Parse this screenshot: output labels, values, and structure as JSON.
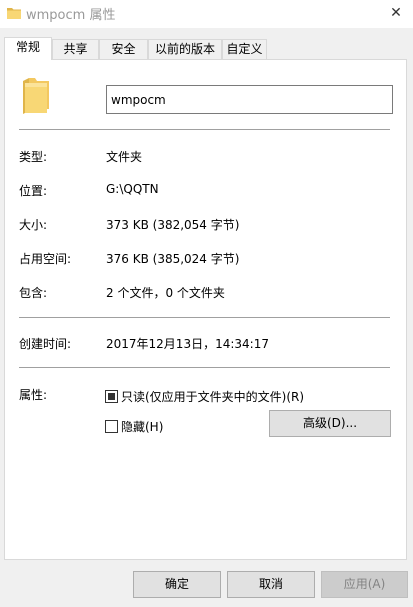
{
  "window": {
    "title": "wmpocm 属性",
    "close_glyph": "✕"
  },
  "tabs": [
    {
      "label": "常规",
      "active": true
    },
    {
      "label": "共享"
    },
    {
      "label": "安全"
    },
    {
      "label": "以前的版本"
    },
    {
      "label": "自定义"
    }
  ],
  "general": {
    "name_value": "wmpocm",
    "properties": [
      {
        "label": "类型:",
        "value": "文件夹"
      },
      {
        "label": "位置:",
        "value": "G:\\QQTN"
      },
      {
        "label": "大小:",
        "value": "373 KB (382,054 字节)"
      },
      {
        "label": "占用空间:",
        "value": "376 KB (385,024 字节)"
      },
      {
        "label": "包含:",
        "value": "2 个文件，0 个文件夹"
      }
    ],
    "created": {
      "label": "创建时间:",
      "value": "2017年12月13日，14:34:17"
    },
    "attributes": {
      "label": "属性:",
      "readonly_label": "只读(仅应用于文件夹中的文件)(R)",
      "hidden_label": "隐藏(H)",
      "advanced_label": "高级(D)..."
    }
  },
  "buttons": {
    "ok": "确定",
    "cancel": "取消",
    "apply": "应用(A)"
  },
  "colors": {
    "folder_yellow": "#f8d775",
    "folder_dark": "#e0b54a"
  }
}
